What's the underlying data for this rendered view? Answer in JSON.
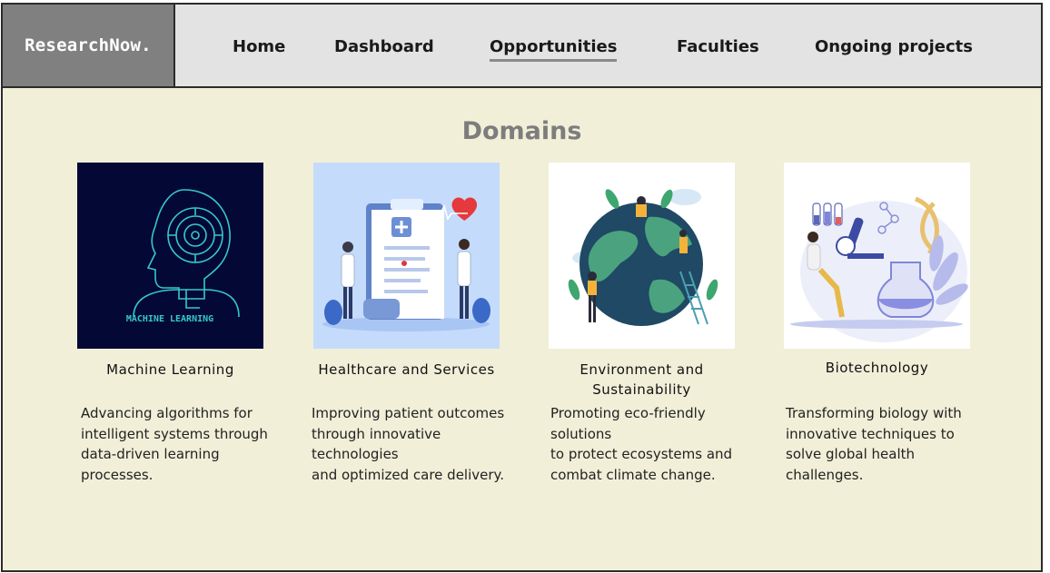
{
  "brand": "ResearchNow.",
  "nav": [
    {
      "label": "Home"
    },
    {
      "label": "Dashboard"
    },
    {
      "label": "Opportunities"
    },
    {
      "label": "Faculties"
    },
    {
      "label": "Ongoing projects"
    }
  ],
  "active_nav": "Opportunities",
  "section_title": "Domains",
  "domains": [
    {
      "title": "Machine Learning",
      "image_text": "MACHINE LEARNING",
      "description": "Advancing algorithms for\nintelligent systems through\ndata-driven learning\nprocesses."
    },
    {
      "title": "Healthcare and Services",
      "description": "Improving patient outcomes\nthrough innovative\ntechnologies\nand optimized care delivery."
    },
    {
      "title": "Environment and Sustainability",
      "description": "Promoting eco-friendly\nsolutions\nto protect ecosystems and\ncombat climate change."
    },
    {
      "title": "Biotechnology",
      "description": "Transforming biology with\ninnovative techniques to\nsolve global health\nchallenges."
    }
  ],
  "colors": {
    "page_bg": "#f1efd8",
    "topbar_bg": "#e3e3e3",
    "logo_bg": "#808080",
    "title": "#7d7d7d"
  }
}
